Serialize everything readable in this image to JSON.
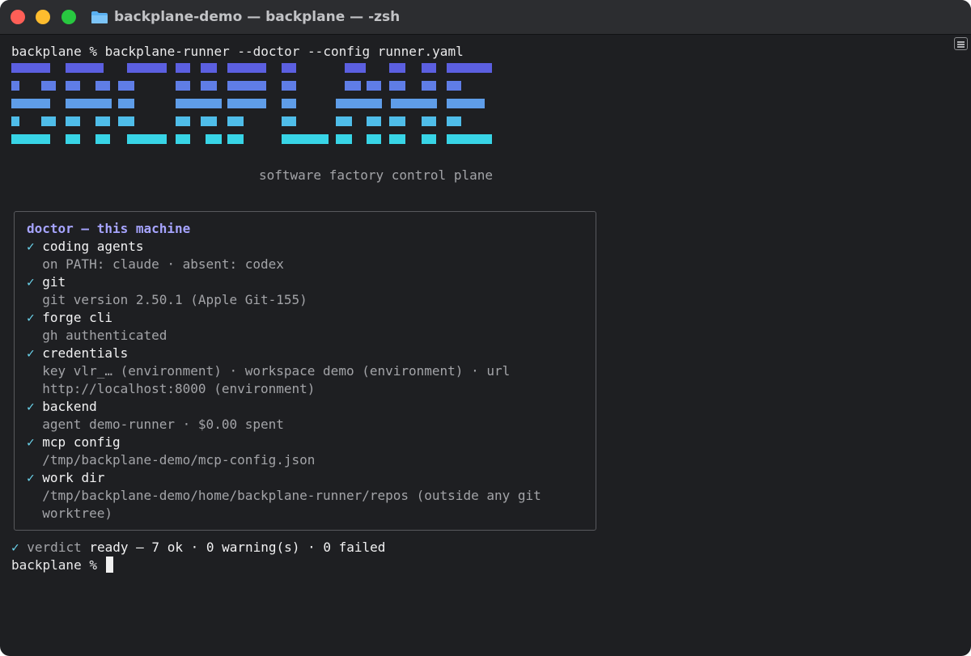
{
  "window": {
    "title": "backplane-demo — backplane — -zsh"
  },
  "colors": {
    "background": "#1e1f22",
    "logo_gradient": [
      "#5b5fe0",
      "#5f7de6",
      "#5f9de8",
      "#4fbde9",
      "#38d4e6"
    ],
    "check": "#6cd6ef",
    "doctor_title": "#a6a4ff"
  },
  "terminal": {
    "command_line": "backplane % backplane-runner --doctor --config runner.yaml",
    "logo_word": "BACKPLANE",
    "tagline": "software factory control plane",
    "doctor": {
      "title": "doctor — this machine",
      "checks": [
        {
          "mark": "✓",
          "name": "coding agents",
          "details": [
            "on PATH: claude · absent: codex"
          ]
        },
        {
          "mark": "✓",
          "name": "git",
          "details": [
            "git version 2.50.1 (Apple Git-155)"
          ]
        },
        {
          "mark": "✓",
          "name": "forge cli",
          "details": [
            "gh authenticated"
          ]
        },
        {
          "mark": "✓",
          "name": "credentials",
          "details": [
            "key vlr_… (environment) · workspace demo (environment) · url",
            "http://localhost:8000 (environment)"
          ]
        },
        {
          "mark": "✓",
          "name": "backend",
          "details": [
            "agent demo-runner · $0.00 spent"
          ]
        },
        {
          "mark": "✓",
          "name": "mcp config",
          "details": [
            "/tmp/backplane-demo/mcp-config.json"
          ]
        },
        {
          "mark": "✓",
          "name": "work dir",
          "details": [
            "/tmp/backplane-demo/home/backplane-runner/repos (outside any git",
            "worktree)"
          ]
        }
      ]
    },
    "verdict": {
      "mark": "✓",
      "label": "verdict",
      "text": "ready — 7 ok · 0 warning(s) · 0 failed"
    },
    "prompt": "backplane %"
  }
}
